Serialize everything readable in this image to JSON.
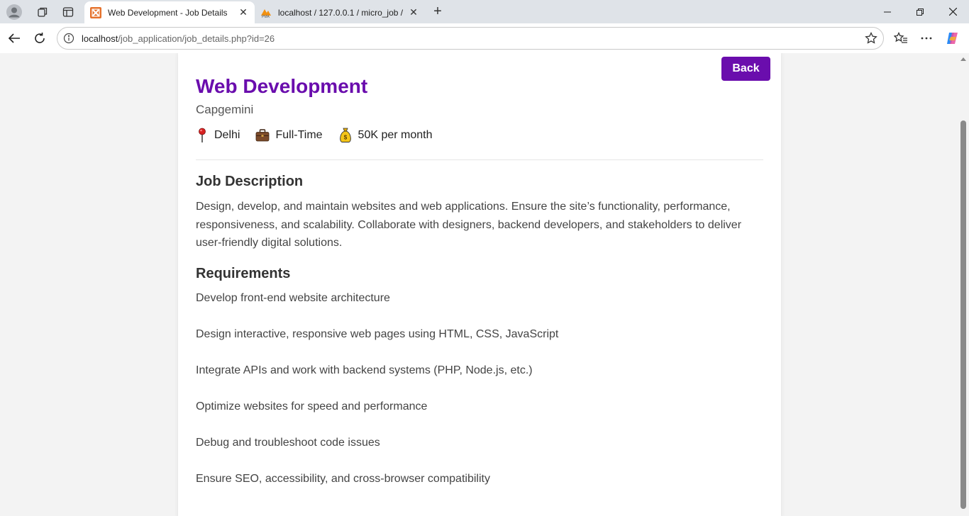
{
  "browser": {
    "tabs": [
      {
        "title": "Web Development - Job Details",
        "active": true,
        "icon": "xampp-icon"
      },
      {
        "title": "localhost / 127.0.0.1 / micro_job /",
        "active": false,
        "icon": "phpmyadmin-icon"
      }
    ],
    "address": {
      "host": "localhost",
      "path": "/job_application/job_details.php?id=26"
    },
    "accent": "#6a0dad"
  },
  "job": {
    "back_label": "Back",
    "title": "Web Development",
    "company": "Capgemini",
    "location": "Delhi",
    "type": "Full-Time",
    "salary": "50K per month",
    "description_heading": "Job Description",
    "description": "Design, develop, and maintain websites and web applications. Ensure the site’s functionality, performance, responsiveness, and scalability. Collaborate with designers, backend developers, and stakeholders to deliver user-friendly digital solutions.",
    "requirements_heading": "Requirements",
    "requirements": [
      "Develop front-end website architecture",
      "Design interactive, responsive web pages using HTML, CSS, JavaScript",
      "Integrate APIs and work with backend systems (PHP, Node.js, etc.)",
      "Optimize websites for speed and performance",
      "Debug and troubleshoot code issues",
      "Ensure SEO, accessibility, and cross-browser compatibility"
    ]
  }
}
